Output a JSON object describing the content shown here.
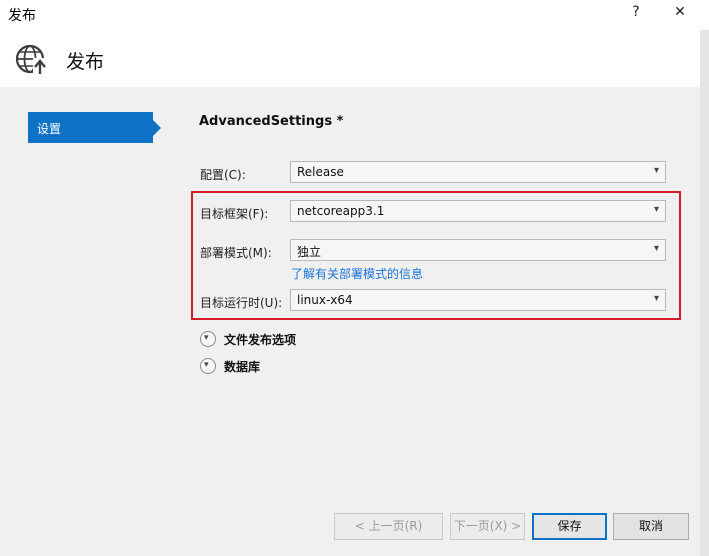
{
  "window": {
    "title": "发布",
    "help_label": "?",
    "close_label": "✕"
  },
  "header": {
    "icon": "globe-publish-icon",
    "title": "发布"
  },
  "sidebar": {
    "items": [
      {
        "label": "设置",
        "selected": true
      }
    ]
  },
  "main": {
    "section_title": "AdvancedSettings *",
    "fields": {
      "configuration": {
        "label": "配置(C):",
        "value": "Release"
      },
      "target_framework": {
        "label": "目标框架(F):",
        "value": "netcoreapp3.1"
      },
      "deployment_mode": {
        "label": "部署模式(M):",
        "value": "独立"
      },
      "deployment_link": "了解有关部署模式的信息",
      "target_runtime": {
        "label": "目标运行时(U):",
        "value": "linux-x64"
      }
    },
    "expanders": [
      {
        "label": "文件发布选项"
      },
      {
        "label": "数据库"
      }
    ]
  },
  "footer": {
    "prev_label": "< 上一页(R)",
    "next_label": "下一页(X) >",
    "save_label": "保存",
    "cancel_label": "取消"
  },
  "colors": {
    "accent": "#0e73c6",
    "highlight_border": "#d71b2b",
    "link": "#1a73d9"
  }
}
